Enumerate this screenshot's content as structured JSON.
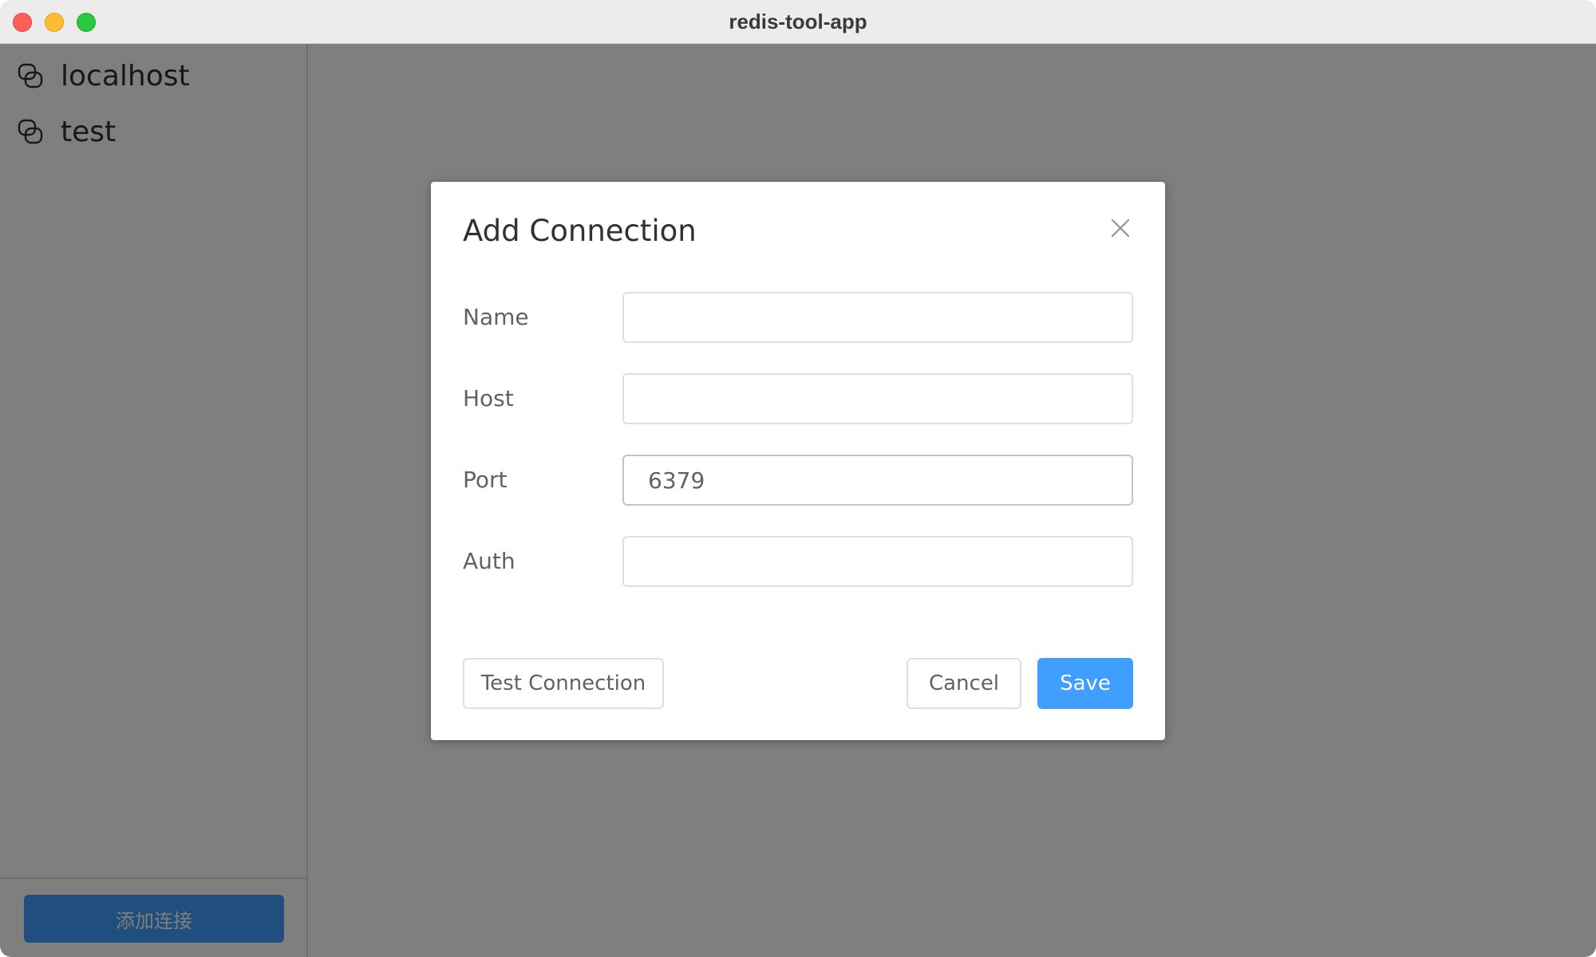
{
  "window": {
    "title": "redis-tool-app"
  },
  "sidebar": {
    "connections": [
      {
        "label": "localhost",
        "icon": "connection-icon"
      },
      {
        "label": "test",
        "icon": "connection-icon"
      }
    ],
    "add_button_label": "添加连接"
  },
  "dialog": {
    "title": "Add Connection",
    "close_icon": "close-icon",
    "fields": {
      "name": {
        "label": "Name",
        "value": ""
      },
      "host": {
        "label": "Host",
        "value": ""
      },
      "port": {
        "label": "Port",
        "value": "6379"
      },
      "auth": {
        "label": "Auth",
        "value": ""
      }
    },
    "buttons": {
      "test_connection": "Test Connection",
      "cancel": "Cancel",
      "save": "Save"
    }
  },
  "colors": {
    "primary": "#409eff",
    "overlay": "rgba(0,0,0,0.5)",
    "text": "#303133",
    "label": "#606266",
    "border": "#dcdfe6"
  }
}
